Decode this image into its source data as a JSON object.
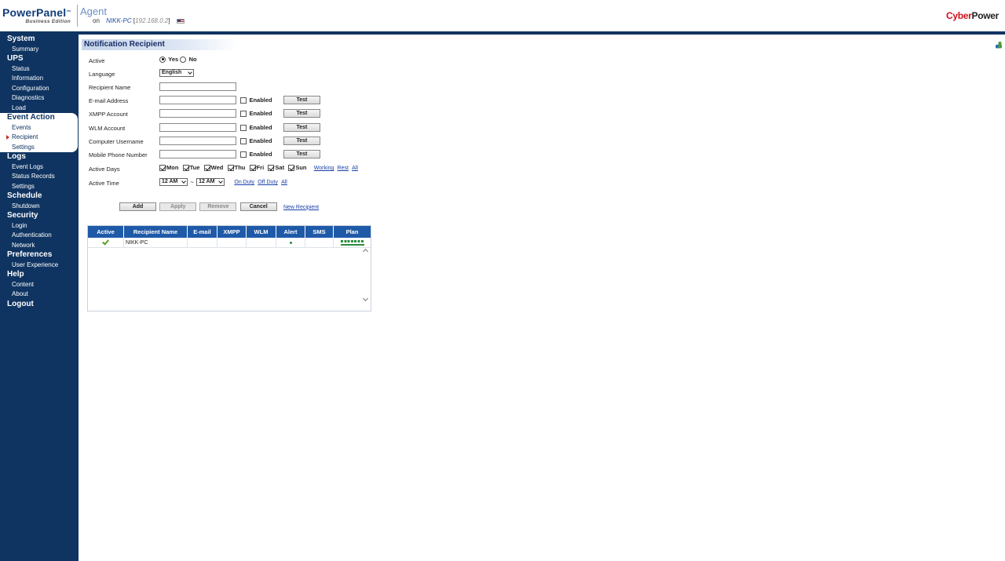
{
  "header": {
    "logo": "PowerPanel",
    "logo_tm": "™",
    "logo_sub": "Business Edition",
    "agent": "Agent",
    "on": "on",
    "host": "NIKK-PC",
    "ip_prefix": "[",
    "ip": "192.168.0.2",
    "ip_suffix": "]",
    "brand_a": "Cyber",
    "brand_b": "Power"
  },
  "sidebar": {
    "groups": [
      {
        "head": "System",
        "items": [
          "Summary"
        ]
      },
      {
        "head": "UPS",
        "items": [
          "Status",
          "Information",
          "Configuration",
          "Diagnostics",
          "Load"
        ]
      },
      {
        "head": "Event Action",
        "items": [
          "Events",
          "Recipient",
          "Settings"
        ]
      },
      {
        "head": "Logs",
        "items": [
          "Event Logs",
          "Status Records",
          "Settings"
        ]
      },
      {
        "head": "Schedule",
        "items": [
          "Shutdown"
        ]
      },
      {
        "head": "Security",
        "items": [
          "Login",
          "Authentication",
          "Network"
        ]
      },
      {
        "head": "Preferences",
        "items": [
          "User Experience"
        ]
      },
      {
        "head": "Help",
        "items": [
          "Content",
          "About"
        ]
      },
      {
        "head": "Logout",
        "items": []
      }
    ]
  },
  "panel": {
    "title": "Notification Recipient",
    "active_label": "Active",
    "yes": "Yes",
    "no": "No",
    "language_label": "Language",
    "language_value": "English",
    "recipient_name_label": "Recipient Name",
    "email_label": "E-mail Address",
    "xmpp_label": "XMPP Account",
    "wlm_label": "WLM Account",
    "computer_label": "Computer Username",
    "mobile_label": "Mobile Phone Number",
    "enabled": "Enabled",
    "test": "Test",
    "active_days_label": "Active Days",
    "days": [
      "Mon",
      "Tue",
      "Wed",
      "Thu",
      "Fri",
      "Sat",
      "Sun"
    ],
    "working": "Working",
    "rest": "Rest",
    "all": "All",
    "active_time_label": "Active Time",
    "time_from": "12 AM",
    "tilde": "~",
    "time_to": "12 AM",
    "on_duty": "On Duty",
    "off_duty": "Off Duty",
    "all_time": "All",
    "add": "Add",
    "apply": "Apply",
    "remove": "Remove",
    "cancel": "Cancel",
    "new_recipient": "New Recipient"
  },
  "table": {
    "headers": [
      "Active",
      "Recipient Name",
      "E-mail",
      "XMPP",
      "WLM",
      "Alert",
      "SMS",
      "Plan"
    ],
    "rows": [
      {
        "active": true,
        "name": "NIKK-PC",
        "email": "",
        "xmpp": "",
        "wlm": "",
        "alert": true,
        "sms": "",
        "plan": "all-days"
      }
    ]
  },
  "colors": {
    "sidebar_bg": "#0f3461",
    "header_blue": "#1f5aa8",
    "accent_green": "#2b8a3e",
    "brand_red": "#d0101a"
  }
}
